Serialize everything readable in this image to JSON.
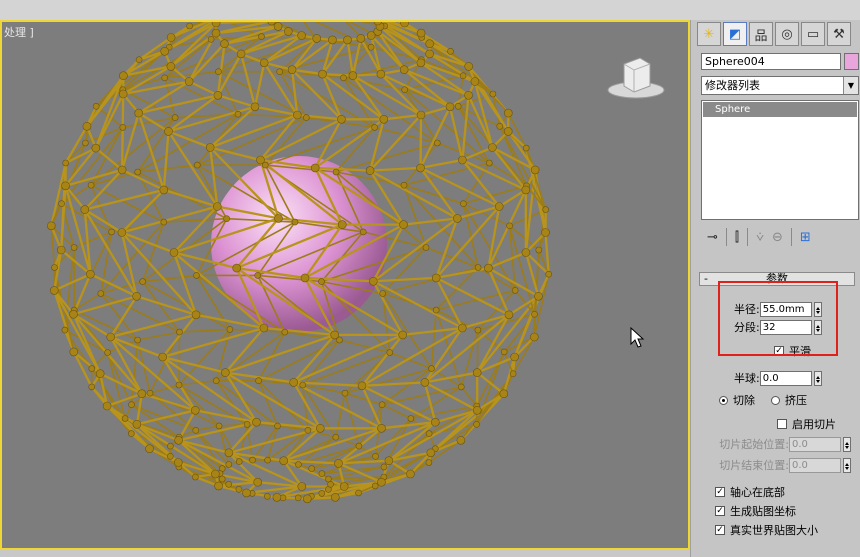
{
  "viewport": {
    "label": "处理 ]"
  },
  "panel": {
    "object_name": "Sphere004",
    "object_color": "#e8a6dc",
    "modifier_list": "修改器列表",
    "stack_items": [
      "Sphere"
    ],
    "tabs": [
      "create-icon",
      "modify-icon",
      "hierarchy-icon",
      "motion-icon",
      "display-icon",
      "utilities-icon"
    ]
  },
  "params": {
    "title": "参数",
    "radius_label": "半径:",
    "radius_value": "55.0mm",
    "segments_label": "分段:",
    "segments_value": "32",
    "smooth_label": "平滑",
    "hemisphere_label": "半球:",
    "hemisphere_value": "0.0",
    "chop_label": "切除",
    "squash_label": "挤压",
    "slice_on_label": "启用切片",
    "slice_from_label": "切片起始位置:",
    "slice_from_value": "0.0",
    "slice_to_label": "切片结束位置:",
    "slice_to_value": "0.0",
    "base_to_pivot_label": "轴心在底部",
    "gen_map_label": "生成贴图坐标",
    "real_world_label": "真实世界贴图大小"
  },
  "colors": {
    "accent": "#f0d633",
    "wire": "#b8941c",
    "sphere": "#e8a6dc",
    "highlight": "#e0201a"
  }
}
